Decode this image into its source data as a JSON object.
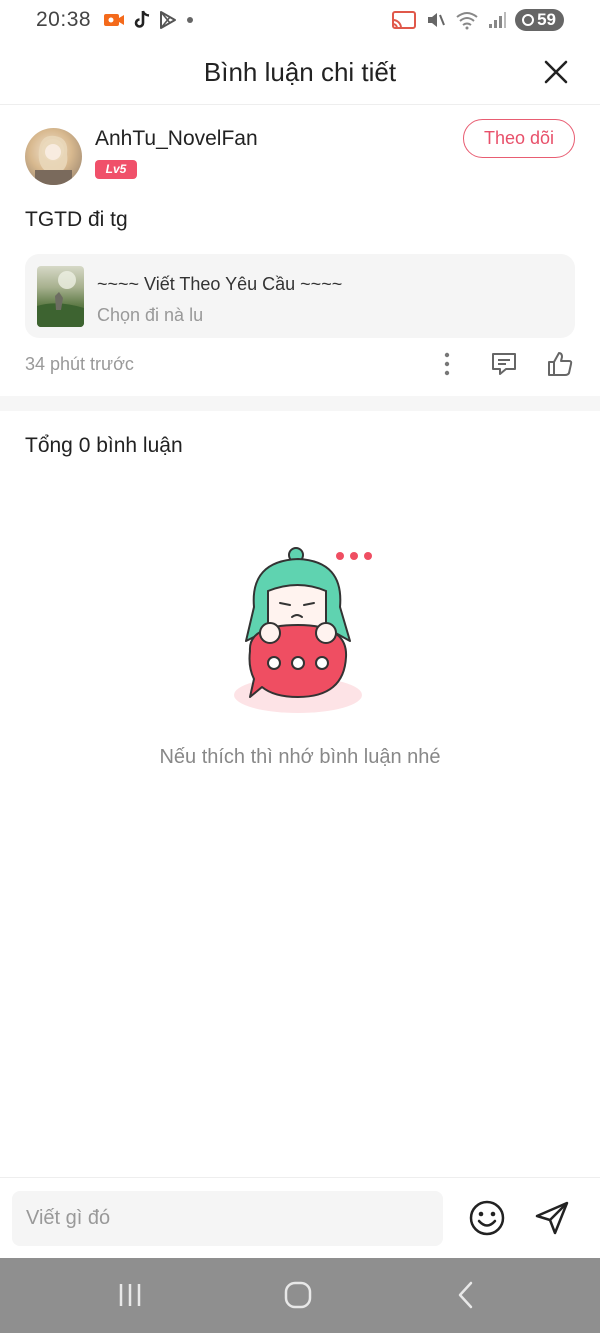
{
  "status_bar": {
    "time": "20:38",
    "battery": "59"
  },
  "header": {
    "title": "Bình luận chi tiết"
  },
  "comment": {
    "author": "AnhTu_NovelFan",
    "level": "Lv5",
    "follow_label": "Theo dõi",
    "text": "TGTD đi tg",
    "book": {
      "title": "~~~~ Viết Theo Yêu Cầu ~~~~",
      "subtitle": "Chọn đi nà lu"
    },
    "timestamp": "34 phút trước"
  },
  "replies": {
    "total_label": "Tổng 0 bình luận",
    "empty_message": "Nếu thích thì nhớ bình luận nhé"
  },
  "input": {
    "placeholder": "Viết gì đó"
  },
  "colors": {
    "accent": "#e8506a",
    "level_badge": "#f0506a",
    "mascot_hair": "#5fd3b0",
    "mascot_bubble": "#ef4e62"
  },
  "icons": {
    "close": "close-icon",
    "more": "more-vertical-icon",
    "comment": "comment-icon",
    "like": "thumbs-up-icon",
    "emoji": "emoji-icon",
    "send": "send-icon"
  }
}
